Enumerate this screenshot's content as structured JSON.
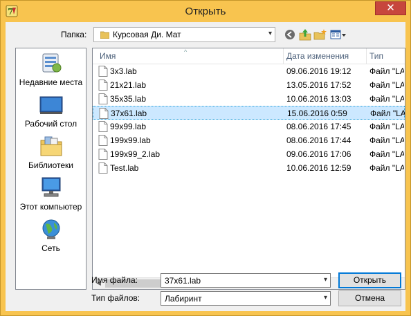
{
  "window": {
    "title": "Открыть",
    "close_glyph": "✕"
  },
  "lookin": {
    "label": "Папка:",
    "value": "Курсовая Ди. Мат",
    "arrow": "▾"
  },
  "toolbar": {
    "back": "back-icon",
    "up": "up-folder-icon",
    "new_folder": "new-folder-icon",
    "view": "view-menu-icon"
  },
  "places": [
    {
      "label": "Недавние места",
      "icon": "recent-places-icon"
    },
    {
      "label": "Рабочий стол",
      "icon": "desktop-icon"
    },
    {
      "label": "Библиотеки",
      "icon": "libraries-icon"
    },
    {
      "label": "Этот компьютер",
      "icon": "computer-icon"
    },
    {
      "label": "Сеть",
      "icon": "network-icon"
    }
  ],
  "columns": {
    "name": "Имя",
    "date": "Дата изменения",
    "type": "Тип"
  },
  "files": [
    {
      "name": "3x3.lab",
      "date": "09.06.2016 19:12",
      "type": "Файл \"LAB\""
    },
    {
      "name": "21x21.lab",
      "date": "13.05.2016 17:52",
      "type": "Файл \"LAB\""
    },
    {
      "name": "35x35.lab",
      "date": "10.06.2016 13:03",
      "type": "Файл \"LAB\""
    },
    {
      "name": "37x61.lab",
      "date": "15.06.2016 0:59",
      "type": "Файл \"LAB\""
    },
    {
      "name": "99x99.lab",
      "date": "08.06.2016 17:45",
      "type": "Файл \"LAB\""
    },
    {
      "name": "199x99.lab",
      "date": "08.06.2016 17:44",
      "type": "Файл \"LAB\""
    },
    {
      "name": "199x99_2.lab",
      "date": "09.06.2016 17:06",
      "type": "Файл \"LAB\""
    },
    {
      "name": "Test.lab",
      "date": "10.06.2016 12:59",
      "type": "Файл \"LAB\""
    }
  ],
  "selected_file": "37x61.lab",
  "filename": {
    "label": "Имя файла:",
    "value": "37x61.lab"
  },
  "filetype": {
    "label": "Тип файлов:",
    "value": "Лабиринт"
  },
  "buttons": {
    "open": "Открыть",
    "cancel": "Отмена"
  },
  "scroll": {
    "left": "◀",
    "right": "▶"
  },
  "colors": {
    "frame": "#f8c44f",
    "selection": "#cce8ff",
    "header_text": "#4c607a"
  }
}
